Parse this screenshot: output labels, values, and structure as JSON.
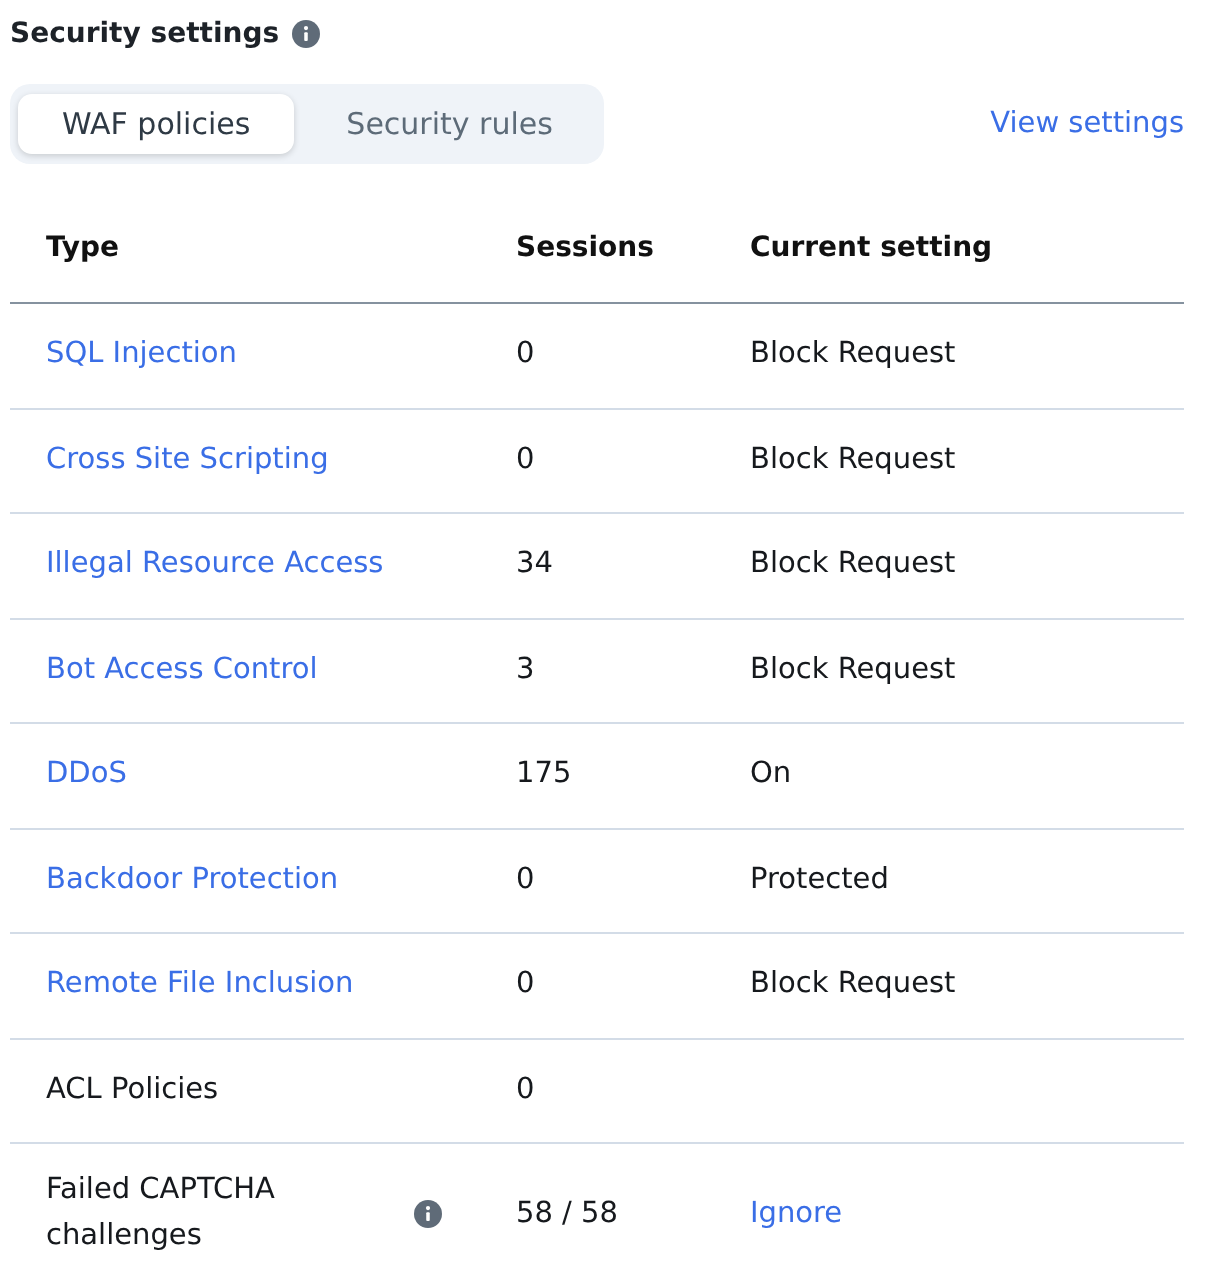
{
  "section": {
    "title": "Security settings"
  },
  "tabs": [
    {
      "label": "WAF policies",
      "selected": true
    },
    {
      "label": "Security rules",
      "selected": false
    }
  ],
  "view_settings_link": "View settings",
  "table": {
    "columns": [
      "Type",
      "Sessions",
      "Current setting"
    ],
    "rows": [
      {
        "type": {
          "text": "SQL Injection",
          "kind": "link"
        },
        "info": false,
        "sessions": "0",
        "setting": {
          "text": "Block Request",
          "kind": "text"
        }
      },
      {
        "type": {
          "text": "Cross Site Scripting",
          "kind": "link"
        },
        "info": false,
        "sessions": "0",
        "setting": {
          "text": "Block Request",
          "kind": "text"
        }
      },
      {
        "type": {
          "text": "Illegal Resource Access",
          "kind": "link"
        },
        "info": false,
        "sessions": "34",
        "setting": {
          "text": "Block Request",
          "kind": "text"
        }
      },
      {
        "type": {
          "text": "Bot Access Control",
          "kind": "link"
        },
        "info": false,
        "sessions": "3",
        "setting": {
          "text": "Block Request",
          "kind": "text"
        }
      },
      {
        "type": {
          "text": "DDoS",
          "kind": "link"
        },
        "info": false,
        "sessions": "175",
        "setting": {
          "text": "On",
          "kind": "text"
        }
      },
      {
        "type": {
          "text": "Backdoor Protection",
          "kind": "link"
        },
        "info": false,
        "sessions": "0",
        "setting": {
          "text": "Protected",
          "kind": "text"
        }
      },
      {
        "type": {
          "text": "Remote File Inclusion",
          "kind": "link"
        },
        "info": false,
        "sessions": "0",
        "setting": {
          "text": "Block Request",
          "kind": "text"
        }
      },
      {
        "type": {
          "text": "ACL Policies",
          "kind": "text"
        },
        "info": false,
        "sessions": "0"
      },
      {
        "type": {
          "text": "Failed CAPTCHA challenges",
          "kind": "text"
        },
        "info": true,
        "sessions": "58 / 58",
        "setting": {
          "text": "Ignore",
          "kind": "link"
        }
      }
    ]
  }
}
